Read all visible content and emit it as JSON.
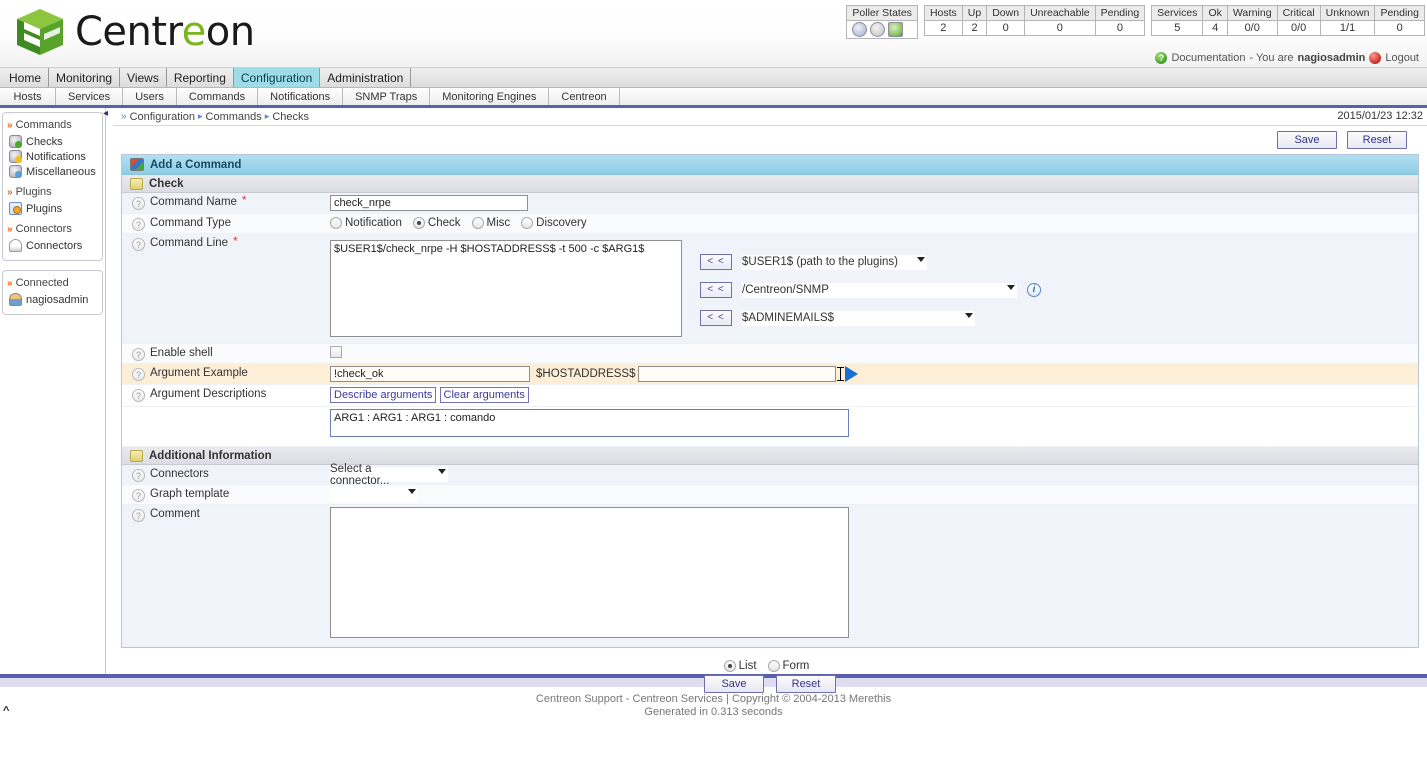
{
  "header": {
    "brand_text_1": "Centr",
    "brand_text_2": "e",
    "brand_text_3": "on",
    "poller_states_label": "Poller States",
    "hosts": {
      "headers": [
        "Hosts",
        "Up",
        "Down",
        "Unreachable",
        "Pending"
      ],
      "values": [
        "2",
        "2",
        "0",
        "0",
        "0"
      ]
    },
    "services": {
      "headers": [
        "Services",
        "Ok",
        "Warning",
        "Critical",
        "Unknown",
        "Pending"
      ],
      "values": [
        "5",
        "4",
        "0/0",
        "0/0",
        "1/1",
        "0"
      ]
    },
    "documentation": "Documentation",
    "user_text": "- You are",
    "username": "nagiosadmin",
    "logout": "Logout"
  },
  "mainnav": {
    "items": [
      {
        "label": "Home",
        "active": false
      },
      {
        "label": "Monitoring",
        "active": false
      },
      {
        "label": "Views",
        "active": false
      },
      {
        "label": "Reporting",
        "active": false
      },
      {
        "label": "Configuration",
        "active": true
      },
      {
        "label": "Administration",
        "active": false
      }
    ]
  },
  "subnav": {
    "items": [
      "Hosts",
      "Services",
      "Users",
      "Commands",
      "Notifications",
      "SNMP Traps",
      "Monitoring Engines",
      "Centreon"
    ]
  },
  "sidebar": {
    "groups": [
      {
        "title": "Commands",
        "items": [
          {
            "label": "Checks",
            "icon": "gear-check-icon"
          },
          {
            "label": "Notifications",
            "icon": "gear-warning-icon"
          },
          {
            "label": "Miscellaneous",
            "icon": "gear-search-icon"
          }
        ]
      },
      {
        "title": "Plugins",
        "items": [
          {
            "label": "Plugins",
            "icon": "plugin-icon"
          }
        ]
      },
      {
        "title": "Connectors",
        "items": [
          {
            "label": "Connectors",
            "icon": "connector-icon"
          }
        ]
      }
    ],
    "connected": {
      "title": "Connected",
      "user": "nagiosadmin"
    }
  },
  "breadcrumb": {
    "items": [
      "Configuration",
      "Commands",
      "Checks"
    ],
    "timestamp": "2015/01/23 12:32"
  },
  "toolbar": {
    "save_label": "Save",
    "reset_label": "Reset"
  },
  "form": {
    "section_title": "Add a Command",
    "check_section": "Check",
    "additional_section": "Additional Information",
    "labels": {
      "command_name": "Command Name",
      "command_type": "Command Type",
      "command_line": "Command Line",
      "enable_shell": "Enable shell",
      "argument_example": "Argument Example",
      "argument_descriptions": "Argument Descriptions",
      "connectors": "Connectors",
      "graph_template": "Graph template",
      "comment": "Comment"
    },
    "command_name_value": "check_nrpe",
    "command_type_options": [
      {
        "label": "Notification",
        "selected": false
      },
      {
        "label": "Check",
        "selected": true
      },
      {
        "label": "Misc",
        "selected": false
      },
      {
        "label": "Discovery",
        "selected": false
      }
    ],
    "command_line_value": "$USER1$/check_nrpe -H $HOSTADDRESS$ -t 500 -c $ARG1$",
    "macros": [
      {
        "button": "< <",
        "value": "$USER1$ (path to the plugins)"
      },
      {
        "button": "< <",
        "value": "/Centreon/SNMP"
      },
      {
        "button": "< <",
        "value": "$ADMINEMAILS$"
      }
    ],
    "enable_shell_checked": false,
    "argument_example_value": "!check_ok",
    "argument_host_label": "$HOSTADDRESS$",
    "argument_host_value": "",
    "describe_arguments": "Describe arguments",
    "clear_arguments": "Clear arguments",
    "argument_descriptions_value": "ARG1 : ARG1 : ARG1 : comando",
    "connectors_value": "Select a connector...",
    "graph_template_value": "",
    "comment_value": ""
  },
  "bottom": {
    "list_label": "List",
    "form_label": "Form",
    "list_selected": true,
    "save_label": "Save",
    "reset_label": "Reset"
  },
  "footer": {
    "line1": "Centreon Support - Centreon Services | Copyright © 2004-2013 Merethis",
    "line2": "Generated in 0.313 seconds"
  }
}
